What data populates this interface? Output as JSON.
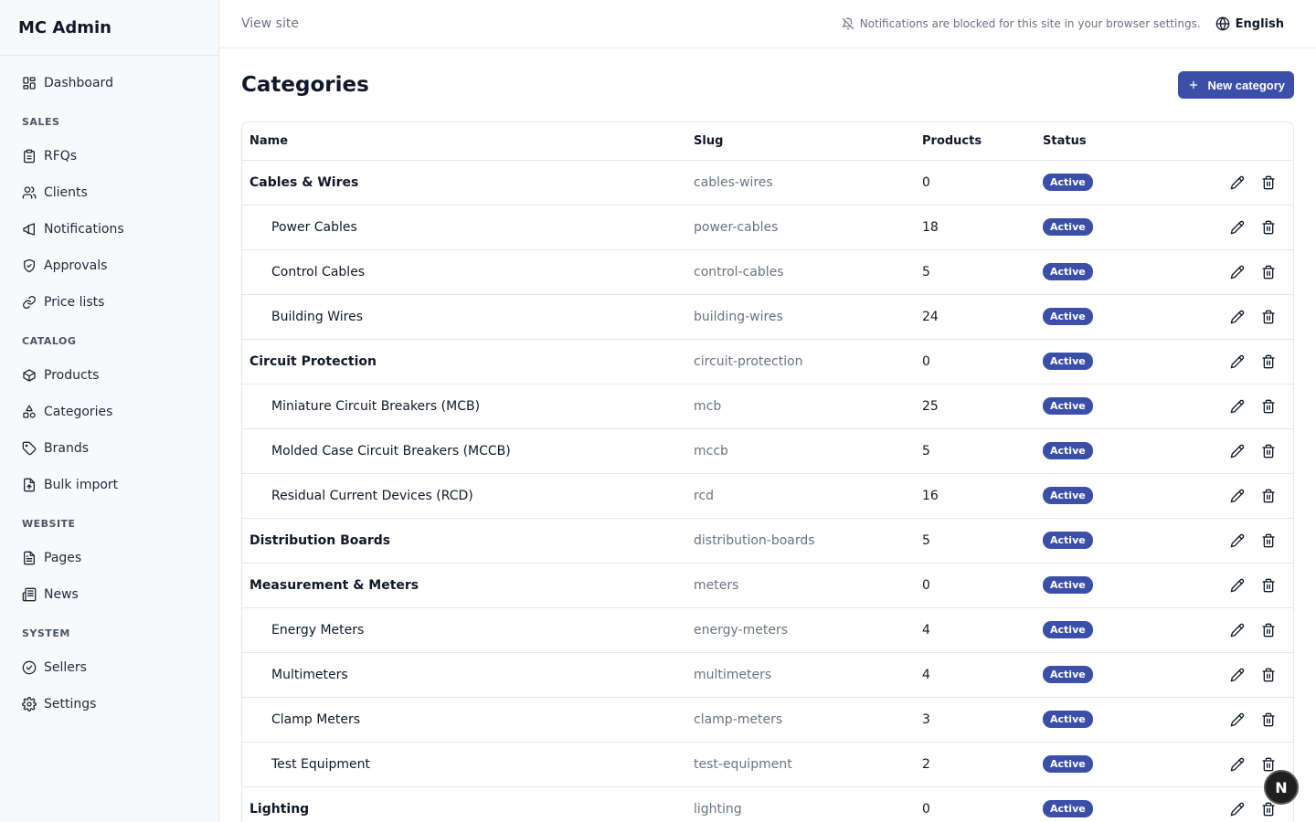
{
  "app": {
    "name": "MC Admin"
  },
  "sidebar": {
    "dashboard": "Dashboard",
    "sections": [
      {
        "title": "SALES",
        "items": [
          {
            "label": "RFQs",
            "icon": "clipboard-icon"
          },
          {
            "label": "Clients",
            "icon": "users-icon"
          },
          {
            "label": "Notifications",
            "icon": "megaphone-icon"
          },
          {
            "label": "Approvals",
            "icon": "shield-check-icon"
          },
          {
            "label": "Price lists",
            "icon": "link-icon"
          }
        ]
      },
      {
        "title": "CATALOG",
        "items": [
          {
            "label": "Products",
            "icon": "box-icon"
          },
          {
            "label": "Categories",
            "icon": "shapes-icon"
          },
          {
            "label": "Brands",
            "icon": "tag-icon"
          },
          {
            "label": "Bulk import",
            "icon": "file-upload-icon"
          }
        ]
      },
      {
        "title": "WEBSITE",
        "items": [
          {
            "label": "Pages",
            "icon": "file-text-icon"
          },
          {
            "label": "News",
            "icon": "newspaper-icon"
          }
        ]
      },
      {
        "title": "SYSTEM",
        "items": [
          {
            "label": "Sellers",
            "icon": "badge-check-icon"
          },
          {
            "label": "Settings",
            "icon": "gear-icon"
          }
        ]
      }
    ]
  },
  "topbar": {
    "view_site": "View site",
    "notice": "Notifications are blocked for this site in your browser settings.",
    "language": "English"
  },
  "page": {
    "title": "Categories",
    "new_button": "New category"
  },
  "table": {
    "headers": {
      "name": "Name",
      "slug": "Slug",
      "products": "Products",
      "status": "Status"
    },
    "rows": [
      {
        "name": "Cables & Wires",
        "slug": "cables-wires",
        "products": "0",
        "status": "Active",
        "level": 0
      },
      {
        "name": "Power Cables",
        "slug": "power-cables",
        "products": "18",
        "status": "Active",
        "level": 1
      },
      {
        "name": "Control Cables",
        "slug": "control-cables",
        "products": "5",
        "status": "Active",
        "level": 1
      },
      {
        "name": "Building Wires",
        "slug": "building-wires",
        "products": "24",
        "status": "Active",
        "level": 1
      },
      {
        "name": "Circuit Protection",
        "slug": "circuit-protection",
        "products": "0",
        "status": "Active",
        "level": 0
      },
      {
        "name": "Miniature Circuit Breakers (MCB)",
        "slug": "mcb",
        "products": "25",
        "status": "Active",
        "level": 1
      },
      {
        "name": "Molded Case Circuit Breakers (MCCB)",
        "slug": "mccb",
        "products": "5",
        "status": "Active",
        "level": 1
      },
      {
        "name": "Residual Current Devices (RCD)",
        "slug": "rcd",
        "products": "16",
        "status": "Active",
        "level": 1
      },
      {
        "name": "Distribution Boards",
        "slug": "distribution-boards",
        "products": "5",
        "status": "Active",
        "level": 0
      },
      {
        "name": "Measurement & Meters",
        "slug": "meters",
        "products": "0",
        "status": "Active",
        "level": 0
      },
      {
        "name": "Energy Meters",
        "slug": "energy-meters",
        "products": "4",
        "status": "Active",
        "level": 1
      },
      {
        "name": "Multimeters",
        "slug": "multimeters",
        "products": "4",
        "status": "Active",
        "level": 1
      },
      {
        "name": "Clamp Meters",
        "slug": "clamp-meters",
        "products": "3",
        "status": "Active",
        "level": 1
      },
      {
        "name": "Test Equipment",
        "slug": "test-equipment",
        "products": "2",
        "status": "Active",
        "level": 1
      },
      {
        "name": "Lighting",
        "slug": "lighting",
        "products": "0",
        "status": "Active",
        "level": 0
      }
    ]
  },
  "fab": {
    "label": "N"
  },
  "colors": {
    "accent": "#3b4fa8",
    "sidebar_bg": "#f8f9fb",
    "border": "#e5e7eb"
  }
}
